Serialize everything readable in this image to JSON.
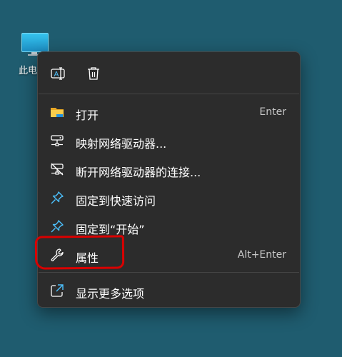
{
  "desktop": {
    "icon_label": "此电"
  },
  "toolbar": {
    "rename_icon": "rename-icon",
    "delete_icon": "trash-icon"
  },
  "menu": {
    "items": [
      {
        "label": "打开",
        "shortcut": "Enter",
        "icon": "folder-icon"
      },
      {
        "label": "映射网络驱动器...",
        "shortcut": "",
        "icon": "network-drive-icon"
      },
      {
        "label": "断开网络驱动器的连接...",
        "shortcut": "",
        "icon": "disconnect-drive-icon"
      },
      {
        "label": "固定到快速访问",
        "shortcut": "",
        "icon": "pin-icon"
      },
      {
        "label": "固定到“开始”",
        "shortcut": "",
        "icon": "pin-icon"
      },
      {
        "label": "属性",
        "shortcut": "Alt+Enter",
        "icon": "wrench-icon"
      },
      {
        "label": "显示更多选项",
        "shortcut": "",
        "icon": "more-options-icon"
      }
    ]
  },
  "colors": {
    "menu_bg": "#2c2c2c",
    "accent": "#4cc2ff",
    "annotation": "#d90000"
  }
}
